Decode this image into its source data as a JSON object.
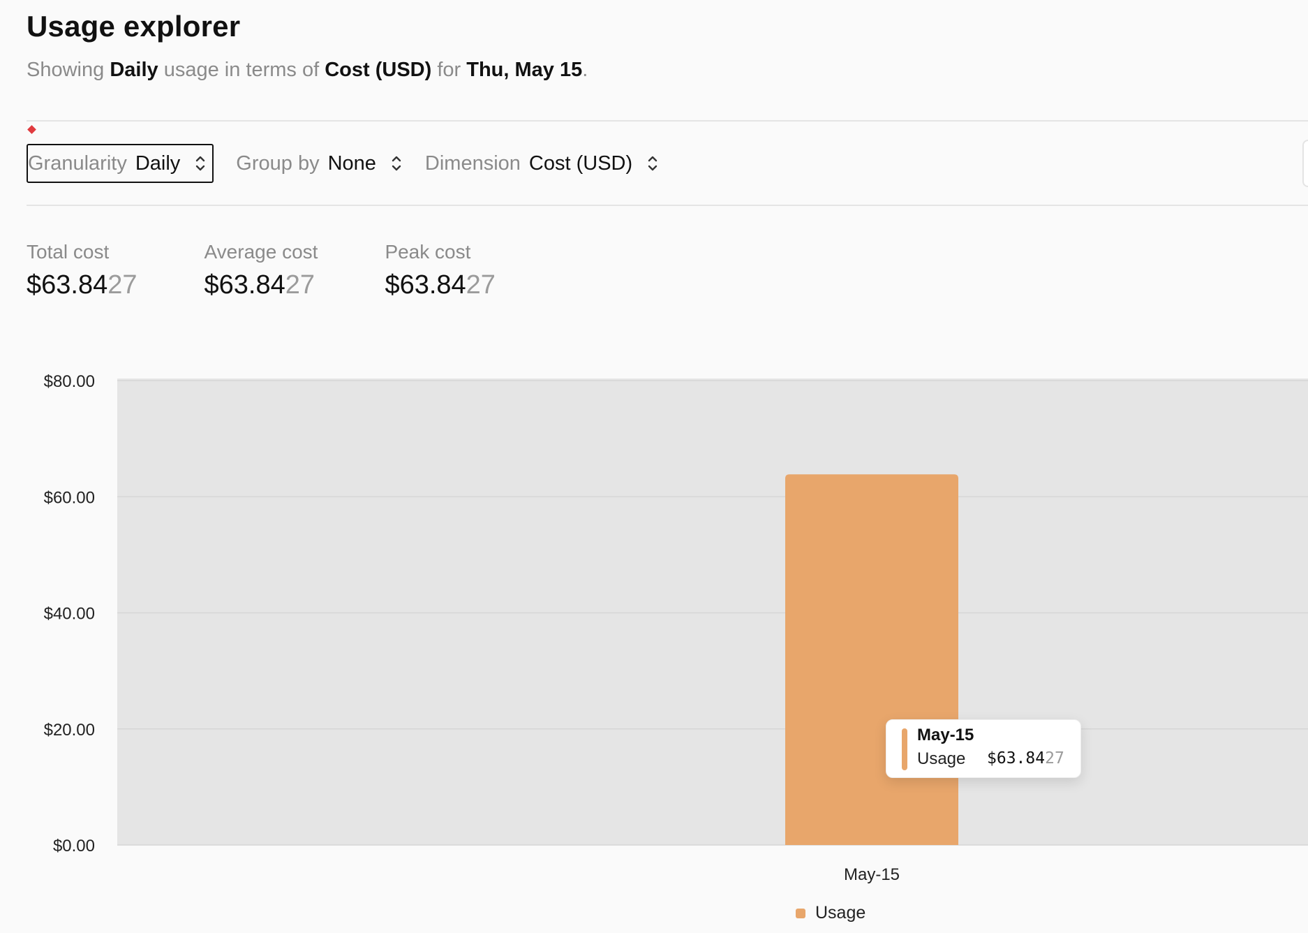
{
  "header": {
    "title": "Usage explorer",
    "subtitle_prefix": "Showing",
    "granularity": "Daily",
    "subtitle_mid": "usage in terms of",
    "dimension": "Cost (USD)",
    "subtitle_for": "for",
    "date": "Thu, May 15",
    "subtitle_end": "."
  },
  "toolbar": {
    "granularity_label": "Granularity",
    "granularity_value": "Daily",
    "group_by_label": "Group by",
    "group_by_value": "None",
    "dimension_label": "Dimension",
    "dimension_value": "Cost (USD)"
  },
  "metrics": {
    "total_label": "Total cost",
    "total_main": "$63.84",
    "total_faint": "27",
    "average_label": "Average cost",
    "average_main": "$63.84",
    "average_faint": "27",
    "peak_label": "Peak cost",
    "peak_main": "$63.84",
    "peak_faint": "27"
  },
  "tooltip": {
    "title": "May-15",
    "series": "Usage",
    "value_main": "$63.84",
    "value_faint": "27"
  },
  "colors": {
    "bar": "#e8a66b",
    "plot_bg": "#e5e5e5",
    "grid": "#d6d6d6"
  },
  "chart_data": {
    "type": "bar",
    "categories": [
      "May-15"
    ],
    "series": [
      {
        "name": "Usage",
        "values": [
          63.8427
        ]
      }
    ],
    "ylim": [
      0,
      80
    ],
    "yticks": [
      0,
      20,
      40,
      60,
      80
    ],
    "ytick_labels": [
      "$0.00",
      "$20.00",
      "$40.00",
      "$60.00",
      "$80.00"
    ],
    "xlabel": "",
    "ylabel": "",
    "grid": true,
    "legend": "bottom-center"
  }
}
